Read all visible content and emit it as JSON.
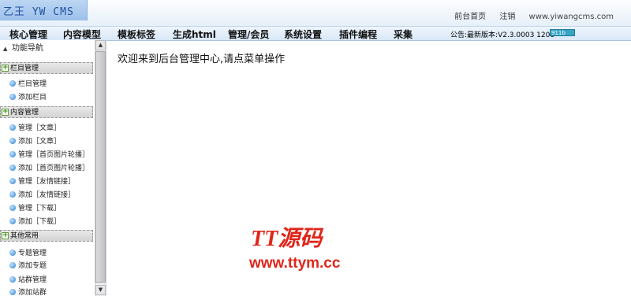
{
  "header": {
    "logo_text": "乙王 YW CMS",
    "links": {
      "home": "前台首页",
      "logout": "注销",
      "site": "www.yiwangcms.com"
    }
  },
  "nav": {
    "items": [
      "核心管理",
      "内容模型",
      "模板标签",
      "生成html",
      "管理/会员",
      "系统设置",
      "插件编程",
      "采集"
    ],
    "notice": "公告:最新版本:V2.3.0003 1208",
    "notice_badge": "911b"
  },
  "sidebar": {
    "title": "功能导航",
    "groups": [
      {
        "label": "栏目管理",
        "items": [
          "栏目管理",
          "添加栏目"
        ]
      },
      {
        "label": "内容管理",
        "items": [
          "管理［文章］",
          "添加［文章］",
          "管理［首页图片轮播］",
          "添加［首页图片轮播］",
          "管理［友情链接］",
          "添加［友情链接］",
          "管理［下载］",
          "添加［下载］"
        ]
      },
      {
        "label": "其他常用",
        "items": [
          "专题管理",
          "添加专题"
        ]
      }
    ],
    "extra_items": [
      "站群管理",
      "添加站群"
    ]
  },
  "main": {
    "welcome": "欢迎来到后台管理中心,请点菜单操作"
  },
  "watermark": {
    "line1": "TT源码",
    "line2": "www.ttym.cc"
  },
  "colors": {
    "accent": "#1f4f9e",
    "watermark": "#e0261b",
    "nav_bg": "#d9e8f7"
  }
}
